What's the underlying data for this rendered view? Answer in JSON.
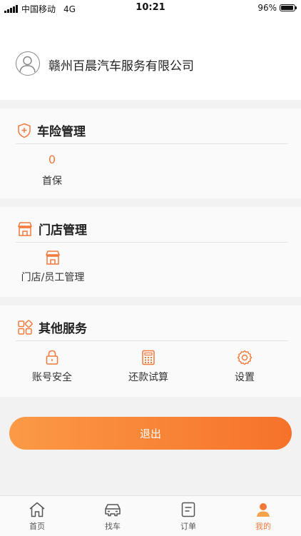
{
  "status_bar": {
    "carrier": "中国移动",
    "network": "4G",
    "time": "10:21",
    "battery": "96%",
    "battery_level": 0.96
  },
  "profile": {
    "company_name": "赣州百晨汽车服务有限公司"
  },
  "sections": {
    "insurance": {
      "title": "车险管理",
      "items": [
        {
          "count": "0",
          "label": "首保"
        }
      ]
    },
    "store": {
      "title": "门店管理",
      "items": [
        {
          "label": "门店/员工管理"
        }
      ]
    },
    "other": {
      "title": "其他服务",
      "items": [
        {
          "label": "账号安全"
        },
        {
          "label": "还款试算"
        },
        {
          "label": "设置"
        }
      ]
    }
  },
  "logout_label": "退出",
  "tabs": [
    {
      "label": "首页",
      "icon": "home-icon"
    },
    {
      "label": "找车",
      "icon": "car-icon"
    },
    {
      "label": "订单",
      "icon": "order-icon"
    },
    {
      "label": "我的",
      "icon": "user-icon",
      "active": true
    }
  ],
  "colors": {
    "accent": "#f2793a",
    "gradient_start": "#fb9a46",
    "gradient_end": "#f6722a"
  }
}
